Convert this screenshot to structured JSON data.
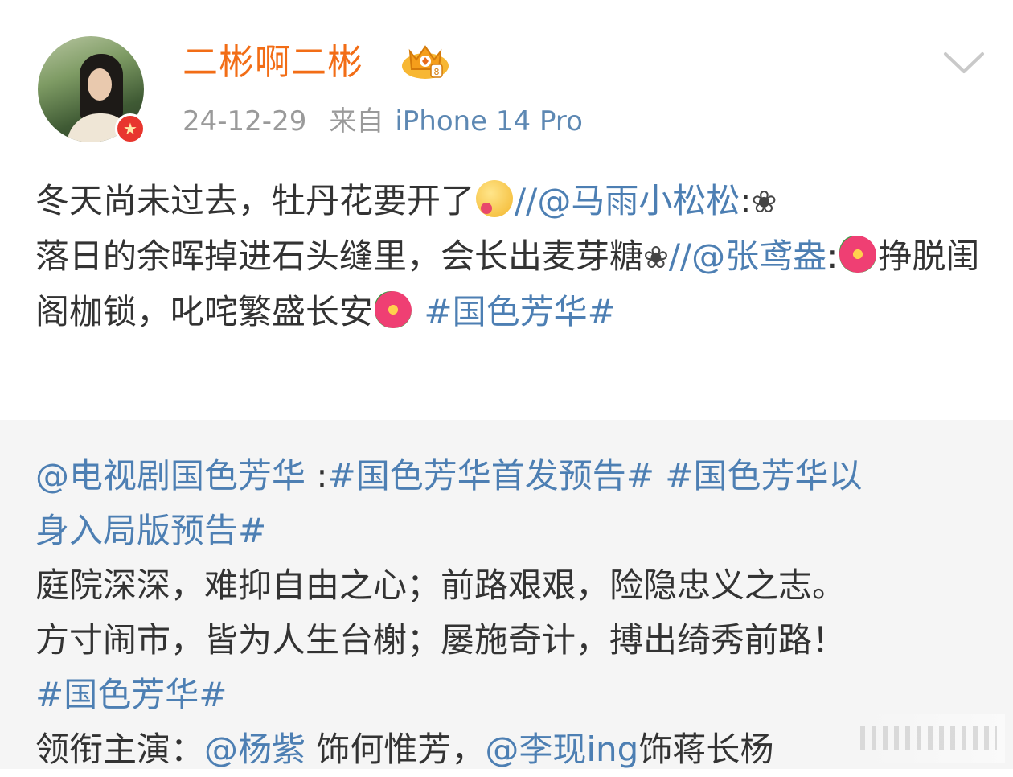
{
  "post": {
    "username": "二彬啊二彬",
    "date": "24-12-29",
    "source_prefix": "来自",
    "source_device": "iPhone 14 Pro",
    "body": {
      "p1": "冬天尚未过去，牡丹花要开了",
      "p2": "//",
      "mention1": "@马雨小松松",
      "colon1": ":",
      "flower_glyph": "❀",
      "p3": "落日的余晖掉进石头缝里，会长出麦芽糖",
      "p4": "//",
      "mention2": "@张鸢盎",
      "colon2": ":",
      "p5": "挣脱闺阁枷锁，叱咤繁盛长安",
      "topic": "#国色芳华#"
    },
    "icons": {
      "crown": "crown-badge-icon",
      "verified": "verified-star-icon",
      "dropdown": "chevron-down-icon",
      "emoji_blush": "blush-emoji-icon",
      "emoji_flower": "hibiscus-emoji-icon"
    },
    "colors": {
      "username": "#f26d16",
      "link": "#4d7fb3",
      "meta": "#9a9a9a",
      "repost_bg": "#f5f5f5"
    }
  },
  "repost": {
    "mention": "@电视剧国色芳华",
    "sep": " :",
    "topic1": "#国色芳华首发预告#",
    "topic2a": "#国色芳华以",
    "topic2b": "身入局版预告#",
    "line3": "庭院深深，难抑自由之心；前路艰艰，险隐忠义之志。",
    "line4": "方寸闹市，皆为人生台榭；屡施奇计，搏出绮秀前路！",
    "topic3": "#国色芳华#",
    "cast_label": "领衔主演：",
    "cast_mention1": "@杨紫",
    "cast_role1": " 饰何惟芳，",
    "cast_mention2": "@李现ing",
    "cast_role2": "饰蒋长杨"
  }
}
